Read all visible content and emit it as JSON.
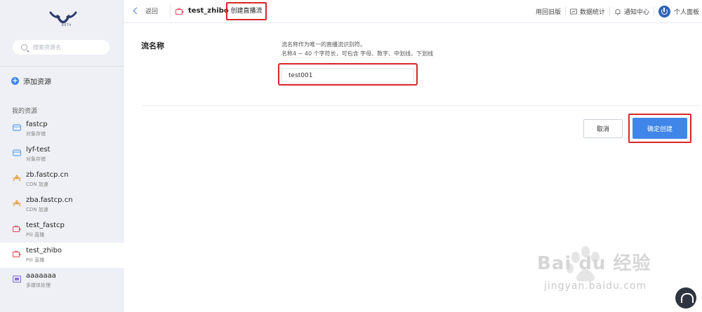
{
  "sidebar": {
    "logo_text": "BETA",
    "search_placeholder": "搜索资源名",
    "add_resource": "添加资源",
    "section_title": "我的资源",
    "items": [
      {
        "name": "fastcp",
        "sub": "对象存储",
        "icon": "storage-icon",
        "color": "#5aa0e6"
      },
      {
        "name": "lyf-test",
        "sub": "对象存储",
        "icon": "storage-icon",
        "color": "#5aa0e6"
      },
      {
        "name": "zb.fastcp.cn",
        "sub": "CDN 加速",
        "icon": "cdn-icon",
        "color": "#e39a3a"
      },
      {
        "name": "zba.fastcp.cn",
        "sub": "CDN 加速",
        "icon": "cdn-icon",
        "color": "#e39a3a"
      },
      {
        "name": "test_fastcp",
        "sub": "Pili 直播",
        "icon": "live-icon",
        "color": "#e5536b"
      },
      {
        "name": "test_zhibo",
        "sub": "Pili 直播",
        "icon": "live-icon",
        "color": "#e5536b",
        "active": true
      },
      {
        "name": "aaaaaaa",
        "sub": "多媒体处理",
        "icon": "media-icon",
        "color": "#8a74d8"
      }
    ]
  },
  "header": {
    "back_label": "返回",
    "resource_name": "test_zhibo",
    "page_title": "创建直播流",
    "links": {
      "old_version": "用回旧版",
      "stats": "数据统计",
      "notifications": "通知中心",
      "profile": "个人面板"
    }
  },
  "form": {
    "label": "流名称",
    "hint_line1": "流名称作为唯一的直播流识别符。",
    "hint_line2": "名称4 ~ 40 个字符长，可包含 字母、数字、中划线、下划线",
    "value": "test001"
  },
  "actions": {
    "cancel": "取消",
    "confirm": "确定创建"
  },
  "watermark": {
    "brand": "Bai du 经验",
    "url": "jingyan.baidu.com"
  },
  "colors": {
    "accent": "#3f86e8",
    "highlight": "#d9262a",
    "sidebar_bg": "#eef0f5"
  }
}
